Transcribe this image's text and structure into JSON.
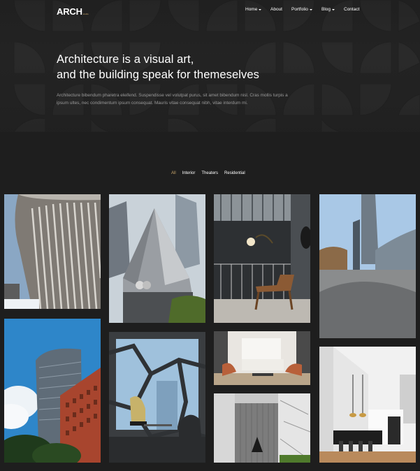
{
  "brand": {
    "logo_text": "ARCH",
    "logo_sub": "studio"
  },
  "nav": {
    "items": [
      {
        "label": "Home",
        "has_dropdown": true
      },
      {
        "label": "About",
        "has_dropdown": false
      },
      {
        "label": "Portfolio",
        "has_dropdown": true
      },
      {
        "label": "Blog",
        "has_dropdown": true
      },
      {
        "label": "Contact",
        "has_dropdown": false
      }
    ]
  },
  "hero": {
    "title_line1": "Architecture is a visual art,",
    "title_line2": "and the building speak for themeselves",
    "description": "Architecture bibendum pharetra eleifend. Suspendisse vel volutpat purus, sit amet bibendum nisl. Cras mollis turpis a ipsum ultes, nec condimentum ipsum consequat. Mauris vitae consequat nibh, vitae interdum mi."
  },
  "filters": {
    "items": [
      "All",
      "Interior",
      "Theaters",
      "Residential"
    ],
    "active": "All"
  },
  "colors": {
    "accent": "#c9a66b",
    "background": "#1e1e1e",
    "hero_bg": "#262626"
  },
  "gallery": {
    "items": [
      {
        "name": "curved-facade-building"
      },
      {
        "name": "angular-silver-building"
      },
      {
        "name": "terrace-with-chair"
      },
      {
        "name": "plaza-with-towers"
      },
      {
        "name": "glass-tower-brick-building"
      },
      {
        "name": "hexagon-window-lounge"
      },
      {
        "name": "white-living-room"
      },
      {
        "name": "bright-kitchen-interior"
      },
      {
        "name": "grey-wall-entrance"
      }
    ]
  }
}
